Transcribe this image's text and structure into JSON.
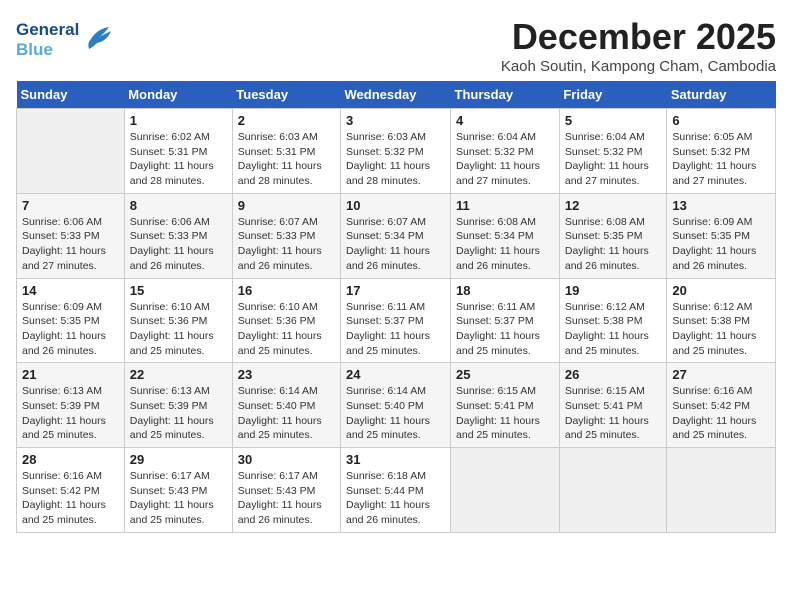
{
  "logo": {
    "line1": "General",
    "line2": "Blue"
  },
  "title": "December 2025",
  "subtitle": "Kaoh Soutin, Kampong Cham, Cambodia",
  "columns": [
    "Sunday",
    "Monday",
    "Tuesday",
    "Wednesday",
    "Thursday",
    "Friday",
    "Saturday"
  ],
  "weeks": [
    [
      {
        "day": "",
        "sunrise": "",
        "sunset": "",
        "daylight": ""
      },
      {
        "day": "1",
        "sunrise": "6:02 AM",
        "sunset": "5:31 PM",
        "daylight": "11 hours and 28 minutes."
      },
      {
        "day": "2",
        "sunrise": "6:03 AM",
        "sunset": "5:31 PM",
        "daylight": "11 hours and 28 minutes."
      },
      {
        "day": "3",
        "sunrise": "6:03 AM",
        "sunset": "5:32 PM",
        "daylight": "11 hours and 28 minutes."
      },
      {
        "day": "4",
        "sunrise": "6:04 AM",
        "sunset": "5:32 PM",
        "daylight": "11 hours and 27 minutes."
      },
      {
        "day": "5",
        "sunrise": "6:04 AM",
        "sunset": "5:32 PM",
        "daylight": "11 hours and 27 minutes."
      },
      {
        "day": "6",
        "sunrise": "6:05 AM",
        "sunset": "5:32 PM",
        "daylight": "11 hours and 27 minutes."
      }
    ],
    [
      {
        "day": "7",
        "sunrise": "6:06 AM",
        "sunset": "5:33 PM",
        "daylight": "11 hours and 27 minutes."
      },
      {
        "day": "8",
        "sunrise": "6:06 AM",
        "sunset": "5:33 PM",
        "daylight": "11 hours and 26 minutes."
      },
      {
        "day": "9",
        "sunrise": "6:07 AM",
        "sunset": "5:33 PM",
        "daylight": "11 hours and 26 minutes."
      },
      {
        "day": "10",
        "sunrise": "6:07 AM",
        "sunset": "5:34 PM",
        "daylight": "11 hours and 26 minutes."
      },
      {
        "day": "11",
        "sunrise": "6:08 AM",
        "sunset": "5:34 PM",
        "daylight": "11 hours and 26 minutes."
      },
      {
        "day": "12",
        "sunrise": "6:08 AM",
        "sunset": "5:35 PM",
        "daylight": "11 hours and 26 minutes."
      },
      {
        "day": "13",
        "sunrise": "6:09 AM",
        "sunset": "5:35 PM",
        "daylight": "11 hours and 26 minutes."
      }
    ],
    [
      {
        "day": "14",
        "sunrise": "6:09 AM",
        "sunset": "5:35 PM",
        "daylight": "11 hours and 26 minutes."
      },
      {
        "day": "15",
        "sunrise": "6:10 AM",
        "sunset": "5:36 PM",
        "daylight": "11 hours and 25 minutes."
      },
      {
        "day": "16",
        "sunrise": "6:10 AM",
        "sunset": "5:36 PM",
        "daylight": "11 hours and 25 minutes."
      },
      {
        "day": "17",
        "sunrise": "6:11 AM",
        "sunset": "5:37 PM",
        "daylight": "11 hours and 25 minutes."
      },
      {
        "day": "18",
        "sunrise": "6:11 AM",
        "sunset": "5:37 PM",
        "daylight": "11 hours and 25 minutes."
      },
      {
        "day": "19",
        "sunrise": "6:12 AM",
        "sunset": "5:38 PM",
        "daylight": "11 hours and 25 minutes."
      },
      {
        "day": "20",
        "sunrise": "6:12 AM",
        "sunset": "5:38 PM",
        "daylight": "11 hours and 25 minutes."
      }
    ],
    [
      {
        "day": "21",
        "sunrise": "6:13 AM",
        "sunset": "5:39 PM",
        "daylight": "11 hours and 25 minutes."
      },
      {
        "day": "22",
        "sunrise": "6:13 AM",
        "sunset": "5:39 PM",
        "daylight": "11 hours and 25 minutes."
      },
      {
        "day": "23",
        "sunrise": "6:14 AM",
        "sunset": "5:40 PM",
        "daylight": "11 hours and 25 minutes."
      },
      {
        "day": "24",
        "sunrise": "6:14 AM",
        "sunset": "5:40 PM",
        "daylight": "11 hours and 25 minutes."
      },
      {
        "day": "25",
        "sunrise": "6:15 AM",
        "sunset": "5:41 PM",
        "daylight": "11 hours and 25 minutes."
      },
      {
        "day": "26",
        "sunrise": "6:15 AM",
        "sunset": "5:41 PM",
        "daylight": "11 hours and 25 minutes."
      },
      {
        "day": "27",
        "sunrise": "6:16 AM",
        "sunset": "5:42 PM",
        "daylight": "11 hours and 25 minutes."
      }
    ],
    [
      {
        "day": "28",
        "sunrise": "6:16 AM",
        "sunset": "5:42 PM",
        "daylight": "11 hours and 25 minutes."
      },
      {
        "day": "29",
        "sunrise": "6:17 AM",
        "sunset": "5:43 PM",
        "daylight": "11 hours and 25 minutes."
      },
      {
        "day": "30",
        "sunrise": "6:17 AM",
        "sunset": "5:43 PM",
        "daylight": "11 hours and 26 minutes."
      },
      {
        "day": "31",
        "sunrise": "6:18 AM",
        "sunset": "5:44 PM",
        "daylight": "11 hours and 26 minutes."
      },
      {
        "day": "",
        "sunrise": "",
        "sunset": "",
        "daylight": ""
      },
      {
        "day": "",
        "sunrise": "",
        "sunset": "",
        "daylight": ""
      },
      {
        "day": "",
        "sunrise": "",
        "sunset": "",
        "daylight": ""
      }
    ]
  ]
}
